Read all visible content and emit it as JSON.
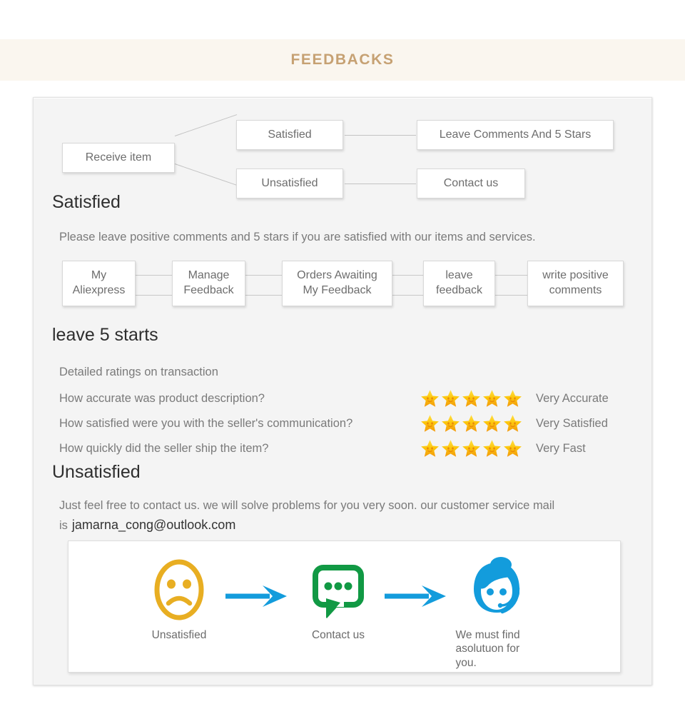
{
  "header": {
    "title": "FEEDBACKS",
    "accent_color": "#c6a173",
    "band_color": "#faf6ef"
  },
  "flowchart": {
    "start": "Receive item",
    "branches": [
      {
        "condition": "Satisfied",
        "action": "Leave Comments And 5 Stars"
      },
      {
        "condition": "Unsatisfied",
        "action": "Contact us"
      }
    ]
  },
  "satisfied": {
    "heading": "Satisfied",
    "description": "Please leave positive comments and 5 stars if you are satisfied with our items and services.",
    "steps": [
      "My\nAliexpress",
      "Manage\nFeedback",
      "Orders Awaiting\nMy Feedback",
      "leave\nfeedback",
      "write positive\ncomments"
    ]
  },
  "ratings": {
    "heading": "leave 5 starts",
    "caption": "Detailed ratings on transaction",
    "star_color": "#f7c51e",
    "star_count": 5,
    "rows": [
      {
        "question": "How accurate was product description?",
        "stars": 5,
        "label": "Very Accurate"
      },
      {
        "question": "How satisfied were you with the seller's communication?",
        "stars": 5,
        "label": "Very Satisfied"
      },
      {
        "question": "How quickly did the seller ship the item?",
        "stars": 5,
        "label": "Very Fast"
      }
    ]
  },
  "unsatisfied": {
    "heading": "Unsatisfied",
    "description": "Just feel free to contact us. we will solve problems for you very soon. our customer service mail is",
    "email": "jamarna_cong@outlook.com"
  },
  "icon_flow": {
    "steps": [
      {
        "icon": "sad-face-icon",
        "caption": "Unsatisfied",
        "color": "#e8ae22"
      },
      {
        "icon": "speech-bubble-icon",
        "caption": "Contact us",
        "color": "#119944"
      },
      {
        "icon": "support-agent-icon",
        "caption": "We must find asolutuon for you.",
        "color": "#139cdc"
      }
    ],
    "arrow_color": "#139cdc"
  }
}
